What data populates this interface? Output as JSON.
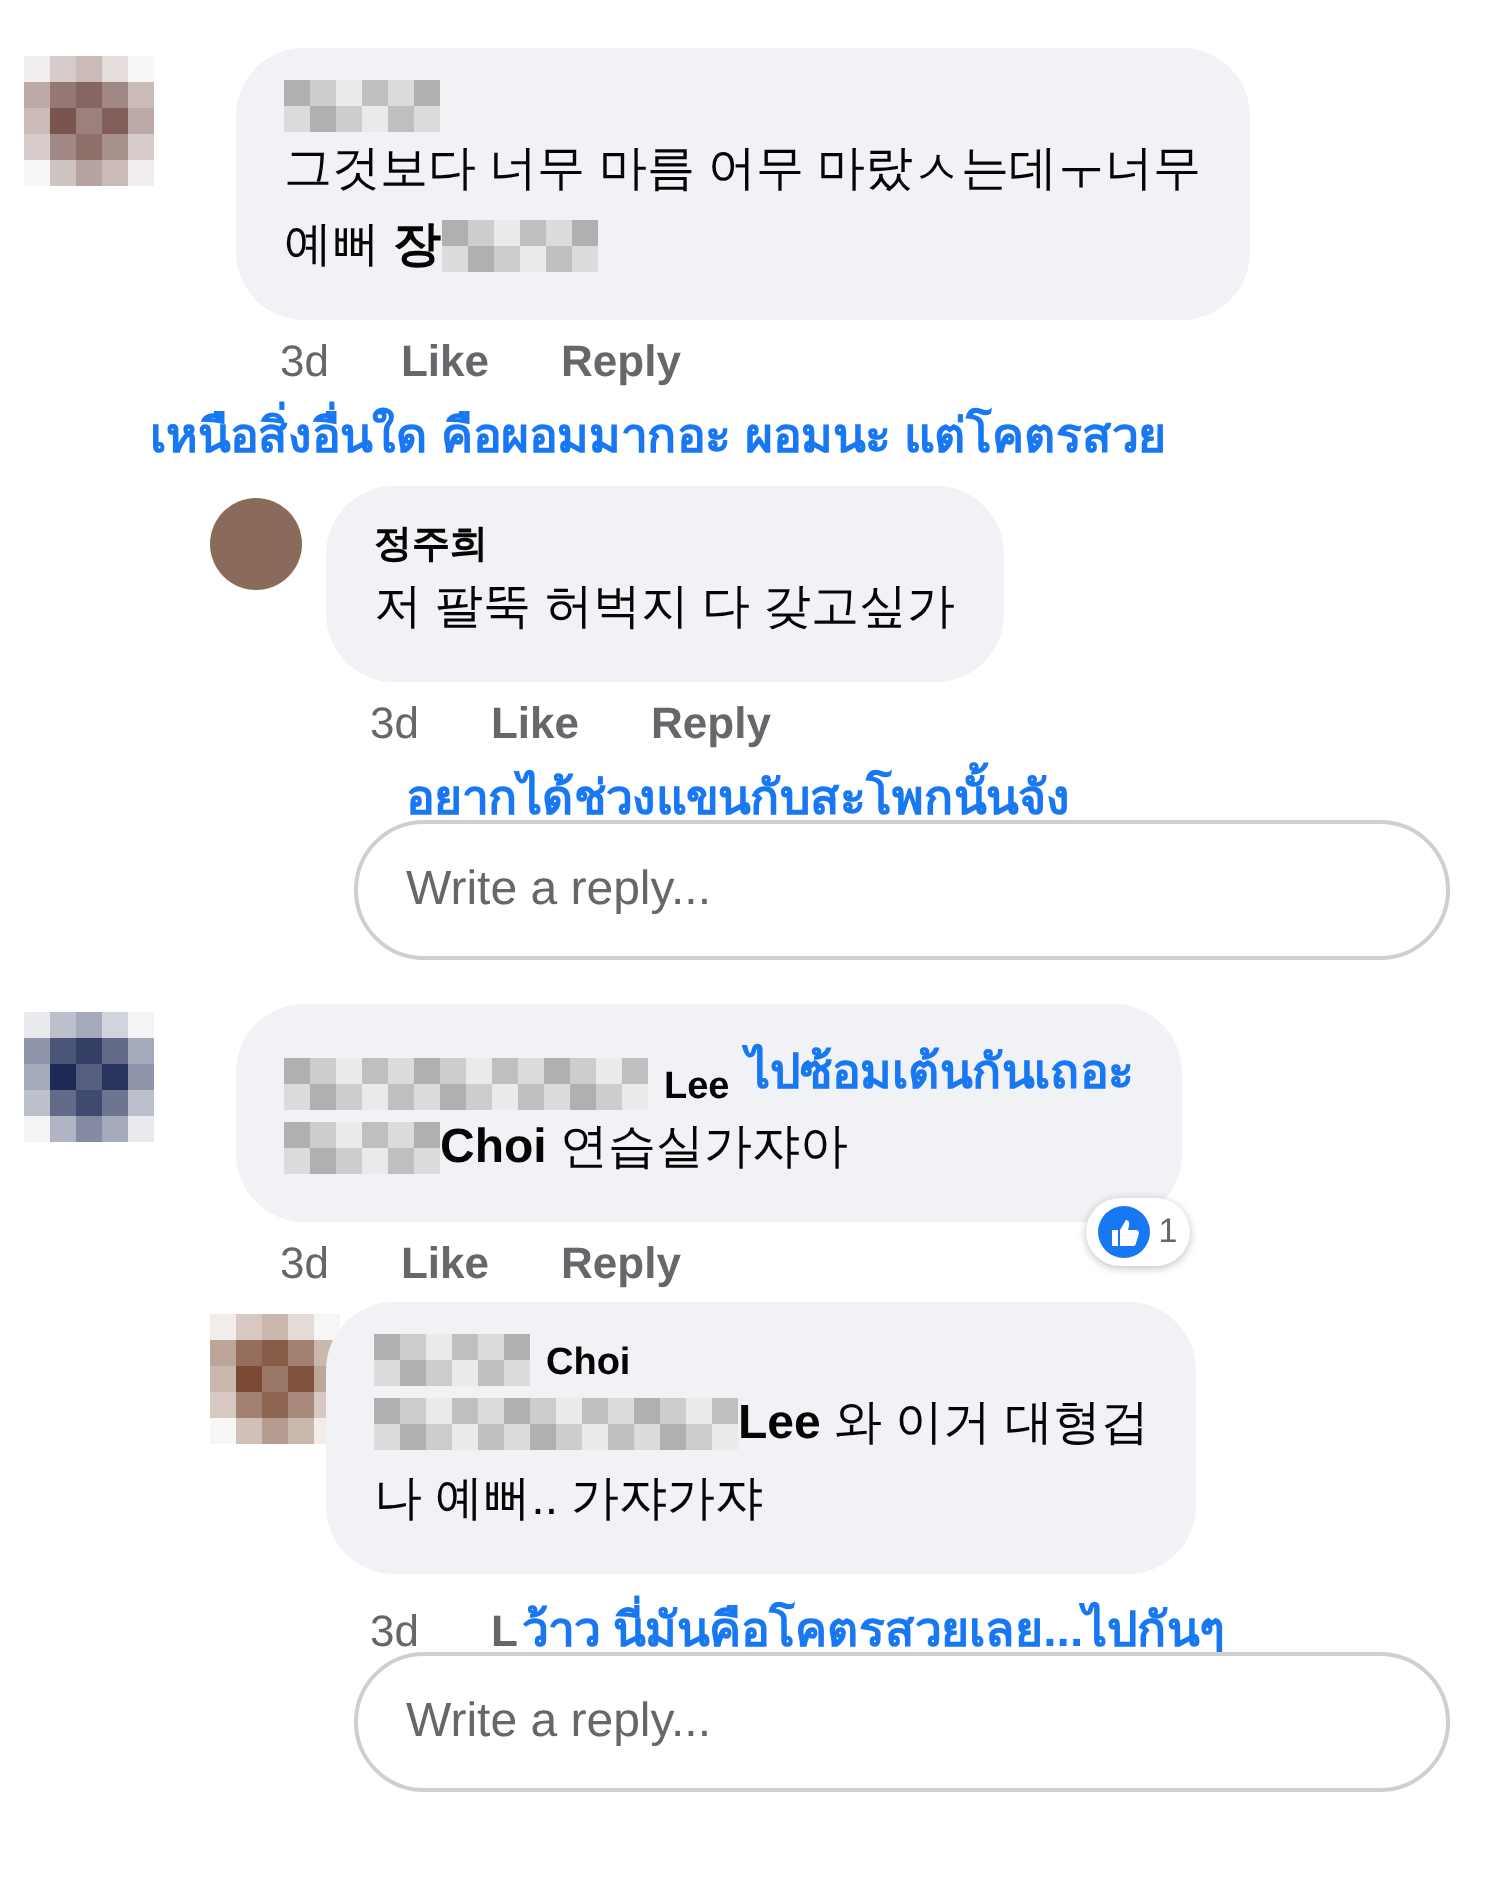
{
  "comments": [
    {
      "avatar": {
        "kind": "mosaic",
        "color": "#7a5550"
      },
      "name": [
        {
          "kind": "blur",
          "wide": false
        }
      ],
      "body": [
        [
          {
            "kind": "text",
            "text": "그것보다 너무 마름 어무 마랐ㅅ는데ㅜ너무"
          }
        ],
        [
          {
            "kind": "text",
            "text": "예뻐 "
          },
          {
            "kind": "mention",
            "text": "장"
          },
          {
            "kind": "blur",
            "wide": false
          }
        ]
      ],
      "actions": [
        {
          "kind": "time",
          "text": "3d"
        },
        {
          "kind": "link",
          "text": "Like"
        },
        {
          "kind": "link",
          "text": "Reply"
        }
      ],
      "caption": {
        "kind": "below",
        "text": "เหนือสิ่งอื่นใด  คือผอมมากอะ  ผอมนะ  แต่โคตรสวย"
      },
      "children": [
        {
          "avatar": {
            "kind": "photo",
            "color": "#8a6a5a"
          },
          "name": [
            {
              "kind": "text",
              "text": "정주희"
            }
          ],
          "body": [
            [
              {
                "kind": "text",
                "text": "저 팔뚝 허벅지 다 갖고싶가"
              }
            ]
          ],
          "actions": [
            {
              "kind": "time",
              "text": "3d"
            },
            {
              "kind": "link",
              "text": "Like"
            },
            {
              "kind": "link",
              "text": "Reply"
            }
          ],
          "caption": {
            "kind": "below",
            "text": "อยากได้ช่วงแขนกับสะโพกนั้นจัง"
          }
        }
      ],
      "reply_box": {
        "placeholder": "Write a reply..."
      }
    },
    {
      "avatar": {
        "kind": "mosaic",
        "color": "#1e2a55"
      },
      "name": [
        {
          "kind": "blur",
          "wide": true
        },
        {
          "kind": "text",
          "text": "Lee"
        }
      ],
      "body": [
        [
          {
            "kind": "blur",
            "wide": false
          },
          {
            "kind": "mention",
            "text": "Choi"
          },
          {
            "kind": "text",
            "text": " 연습실가쟈아"
          }
        ]
      ],
      "actions": [
        {
          "kind": "time",
          "text": "3d"
        },
        {
          "kind": "link",
          "text": "Like"
        },
        {
          "kind": "link",
          "text": "Reply"
        }
      ],
      "caption": {
        "kind": "name",
        "text": "ไปซ้อมเต้นกันเถอะ"
      },
      "reaction": {
        "count": "1"
      },
      "children": [
        {
          "avatar": {
            "kind": "mosaic",
            "color": "#7a4a35"
          },
          "name": [
            {
              "kind": "blur",
              "wide": false
            },
            {
              "kind": "text",
              "text": "Choi"
            }
          ],
          "body": [
            [
              {
                "kind": "blur",
                "wide": true
              },
              {
                "kind": "mention",
                "text": "Lee"
              },
              {
                "kind": "text",
                "text": " 와 이거 대형겁"
              }
            ],
            [
              {
                "kind": "text",
                "text": "나 예뻐.. 가쟈가쟈"
              }
            ]
          ],
          "actions": [
            {
              "kind": "time",
              "text": "3d"
            },
            {
              "kind": "link",
              "text": "L"
            }
          ],
          "caption": {
            "kind": "actions",
            "text": "ว้าว  นี่มันคือโคตรสวยเลย...ไปกันๆ"
          }
        }
      ],
      "reply_box": {
        "placeholder": "Write a reply..."
      }
    }
  ]
}
